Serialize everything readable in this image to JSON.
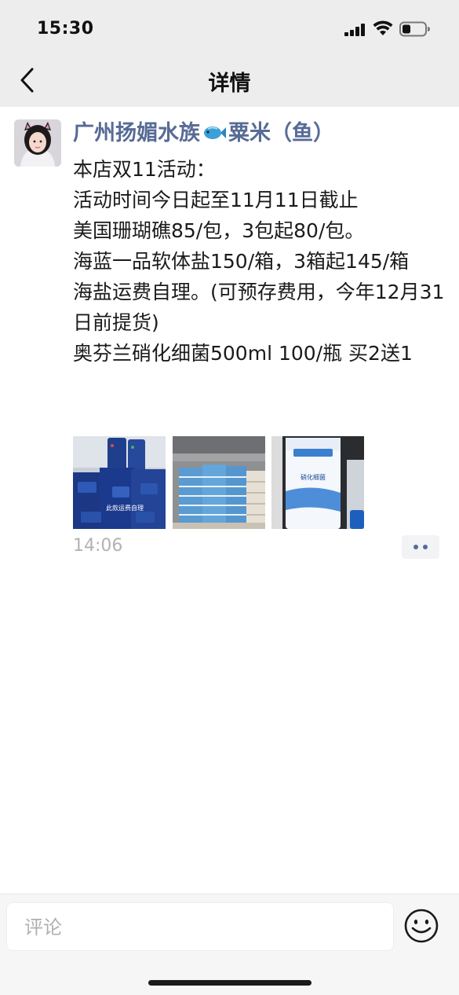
{
  "status_bar": {
    "time": "15:30",
    "icons": [
      "signal-icon",
      "wifi-icon",
      "battery-icon"
    ]
  },
  "nav": {
    "back_icon": "chevron-left-icon",
    "title": "详情"
  },
  "post": {
    "author": {
      "name_part1": "广州扬媚水族",
      "emoji": "fish-icon",
      "name_part2": "粟米（鱼）",
      "color": "#576b95"
    },
    "lines": [
      "本店双11活动：",
      "活动时间今日起至11月11日截止",
      "美国珊瑚礁85/包，3包起80/包。",
      "海蓝一品软体盐150/箱，3箱起145/箱",
      "海盐运费自理。(可预存费用，今年12月31日前提货)",
      "奥芬兰硝化细菌500ml 100/瓶 买2送1"
    ],
    "photos": [
      {
        "caption": "此款运费自理"
      },
      {
        "caption": ""
      },
      {
        "caption": "硝化细菌"
      }
    ],
    "time": "14:06",
    "more_icon": "more-dots-icon"
  },
  "comment_bar": {
    "placeholder": "评论",
    "emoji_icon": "smiley-icon"
  }
}
